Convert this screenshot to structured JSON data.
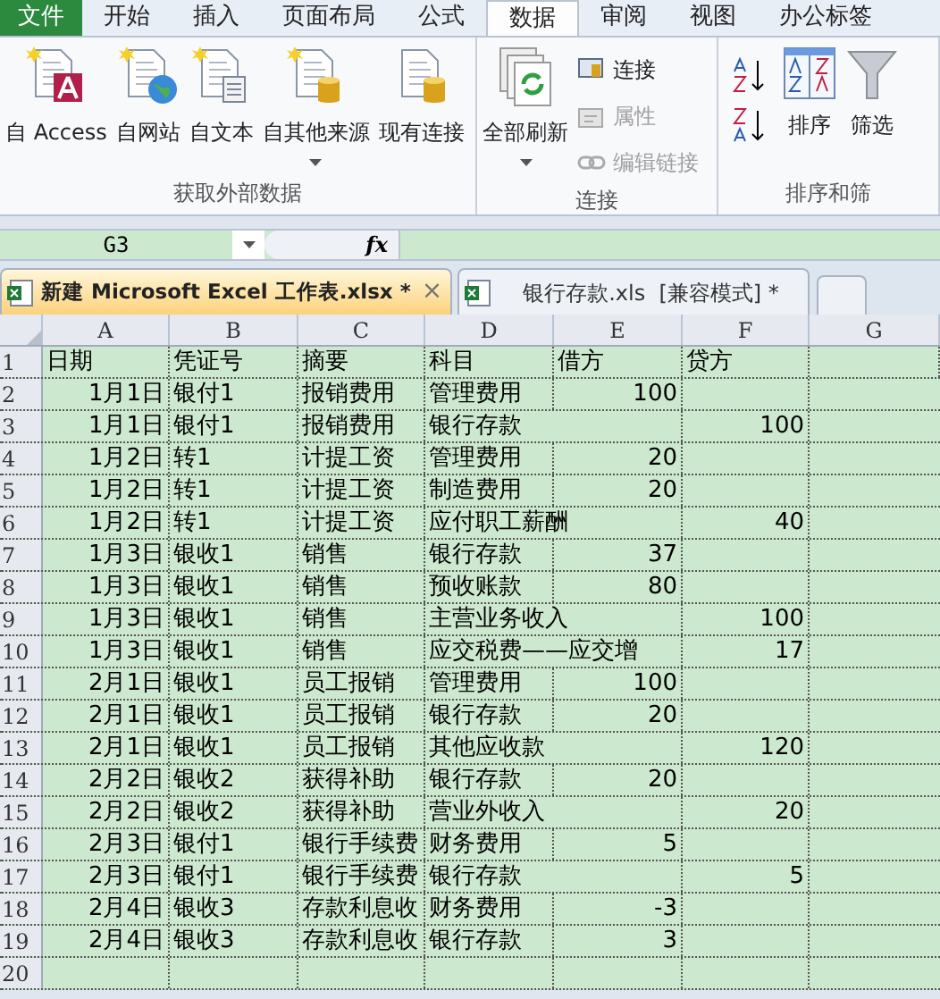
{
  "ribbon_tabs": [
    {
      "label": "文件",
      "kind": "file",
      "selected": false
    },
    {
      "label": "开始",
      "kind": "tab",
      "selected": false
    },
    {
      "label": "插入",
      "kind": "tab",
      "selected": false
    },
    {
      "label": "页面布局",
      "kind": "tab",
      "selected": false
    },
    {
      "label": "公式",
      "kind": "tab",
      "selected": false
    },
    {
      "label": "数据",
      "kind": "tab",
      "selected": true
    },
    {
      "label": "审阅",
      "kind": "tab",
      "selected": false
    },
    {
      "label": "视图",
      "kind": "tab",
      "selected": false
    },
    {
      "label": "办公标签",
      "kind": "tab",
      "selected": false
    }
  ],
  "ribbon_groups": [
    {
      "label": "获取外部数据",
      "buttons": [
        {
          "label": "自 Access",
          "dropdown": false
        },
        {
          "label": "自网站",
          "dropdown": false
        },
        {
          "label": "自文本",
          "dropdown": false
        },
        {
          "label": "自其他来源",
          "dropdown": true
        },
        {
          "label": "现有连接",
          "dropdown": false
        }
      ]
    },
    {
      "label": "连接",
      "buttons": [
        {
          "label": "全部刷新",
          "dropdown": true
        }
      ],
      "small_buttons": [
        {
          "label": "连接",
          "disabled": false
        },
        {
          "label": "属性",
          "disabled": true
        },
        {
          "label": "编辑链接",
          "disabled": true
        }
      ]
    },
    {
      "label": "排序和筛",
      "buttons": [
        {
          "label": "排序",
          "dropdown": false
        },
        {
          "label": "筛选",
          "dropdown": false
        }
      ]
    }
  ],
  "formula_bar": {
    "name_box": "G3",
    "fx": "fx"
  },
  "doc_tabs": [
    {
      "label": "新建 Microsoft Excel 工作表.xlsx *",
      "selected": true,
      "close": "×"
    },
    {
      "label": "银行存款.xls  [兼容模式] *",
      "selected": false
    }
  ],
  "columns": [
    "A",
    "B",
    "C",
    "D",
    "E",
    "F",
    "G"
  ],
  "header_row": {
    "number": "1",
    "labels": [
      "日期",
      "凭证号",
      "摘要",
      "科目",
      "借方",
      "贷方"
    ]
  },
  "rows": [
    {
      "number": "2",
      "date": "1月1日",
      "voucher": "银付1",
      "summary": "报销费用",
      "account": "管理费用",
      "debit": "100"
    },
    {
      "number": "3",
      "date": "1月1日",
      "voucher": "银付1",
      "summary": "报销费用",
      "account": "银行存款",
      "credit": "100"
    },
    {
      "number": "4",
      "date": "1月2日",
      "voucher": "转1",
      "summary": "计提工资",
      "account": "管理费用",
      "debit": "20"
    },
    {
      "number": "5",
      "date": "1月2日",
      "voucher": "转1",
      "summary": "计提工资",
      "account": "制造费用",
      "debit": "20"
    },
    {
      "number": "6",
      "date": "1月2日",
      "voucher": "转1",
      "summary": "计提工资",
      "account": "应付职工薪酬",
      "credit": "40"
    },
    {
      "number": "7",
      "date": "1月3日",
      "voucher": "银收1",
      "summary": "销售",
      "account": "银行存款",
      "debit": "37"
    },
    {
      "number": "8",
      "date": "1月3日",
      "voucher": "银收1",
      "summary": "销售",
      "account": "预收账款",
      "debit": "80"
    },
    {
      "number": "9",
      "date": "1月3日",
      "voucher": "银收1",
      "summary": "销售",
      "account": "主营业务收入",
      "credit": "100"
    },
    {
      "number": "10",
      "date": "1月3日",
      "voucher": "银收1",
      "summary": "销售",
      "account": "应交税费——应交增",
      "credit": "17"
    },
    {
      "number": "11",
      "date": "2月1日",
      "voucher": "银收1",
      "summary": "员工报销",
      "account": "管理费用",
      "debit": "100"
    },
    {
      "number": "12",
      "date": "2月1日",
      "voucher": "银收1",
      "summary": "员工报销",
      "account": "银行存款",
      "debit": "20"
    },
    {
      "number": "13",
      "date": "2月1日",
      "voucher": "银收1",
      "summary": "员工报销",
      "account": "其他应收款",
      "credit": "120"
    },
    {
      "number": "14",
      "date": "2月2日",
      "voucher": "银收2",
      "summary": "获得补助",
      "account": "银行存款",
      "debit": "20"
    },
    {
      "number": "15",
      "date": "2月2日",
      "voucher": "银收2",
      "summary": "获得补助",
      "account": "营业外收入",
      "credit": "20"
    },
    {
      "number": "16",
      "date": "2月3日",
      "voucher": "银付1",
      "summary": "银行手续费",
      "account": "财务费用",
      "debit": "5"
    },
    {
      "number": "17",
      "date": "2月3日",
      "voucher": "银付1",
      "summary": "银行手续费",
      "account": "银行存款",
      "credit": "5"
    },
    {
      "number": "18",
      "date": "2月4日",
      "voucher": "银收3",
      "summary": "存款利息收",
      "account": "财务费用",
      "debit": "-3"
    },
    {
      "number": "19",
      "date": "2月4日",
      "voucher": "银收3",
      "summary": "存款利息收",
      "account": "银行存款",
      "debit": "3"
    },
    {
      "number": "20"
    }
  ]
}
